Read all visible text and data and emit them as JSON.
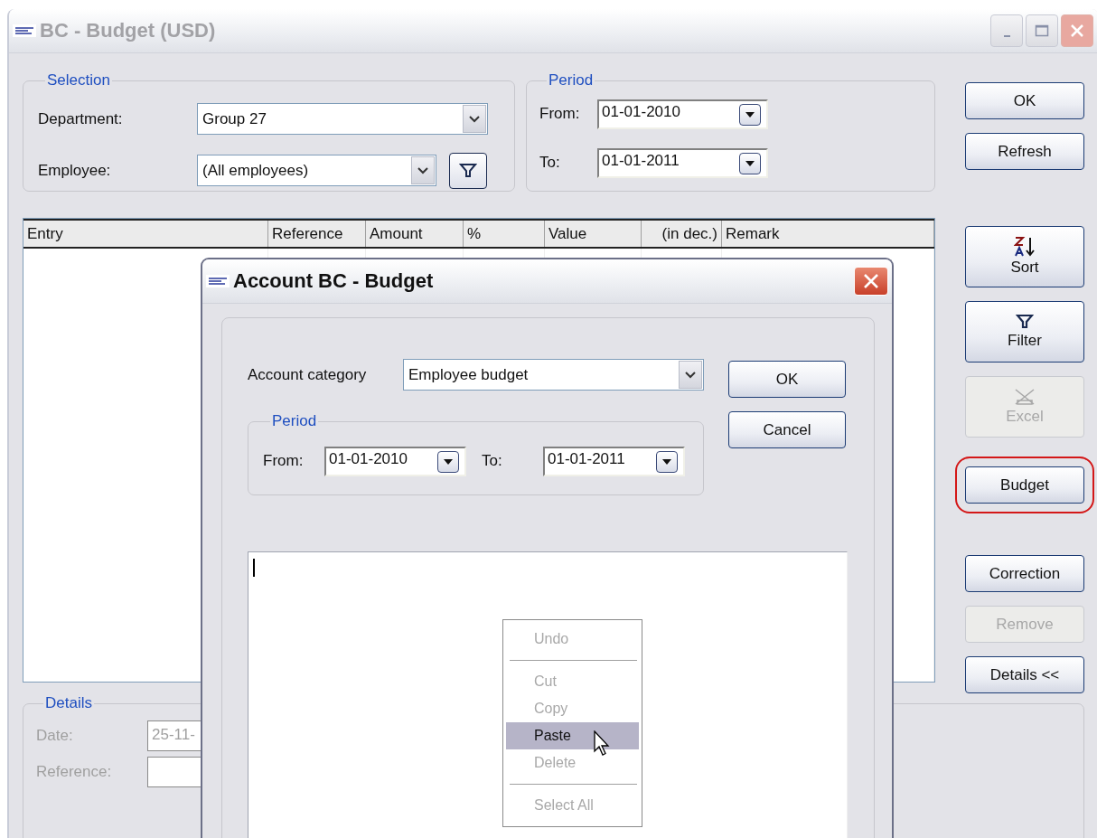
{
  "window": {
    "title": "BC - Budget (USD)",
    "active": false
  },
  "selection": {
    "legend": "Selection",
    "department": {
      "label": "Department:",
      "value": "Group 27"
    },
    "employee": {
      "label": "Employee:",
      "value": "(All employees)"
    }
  },
  "period": {
    "legend": "Period",
    "from": {
      "label": "From:",
      "value": "01-01-2010"
    },
    "to": {
      "label": "To:",
      "value": "01-01-2011"
    }
  },
  "table": {
    "columns": [
      {
        "label": "Entry"
      },
      {
        "label": "Reference"
      },
      {
        "label": "Amount"
      },
      {
        "label": "%"
      },
      {
        "label": "Value"
      },
      {
        "label": "(in dec.)"
      },
      {
        "label": "Remark"
      }
    ]
  },
  "side_buttons": [
    [
      {
        "label": "OK",
        "kind": "text",
        "disabled": false,
        "circled": false
      },
      {
        "label": "Refresh",
        "kind": "text",
        "disabled": false,
        "circled": false
      }
    ],
    [
      {
        "label": "Sort",
        "kind": "sort",
        "disabled": false,
        "circled": false
      },
      {
        "label": "Filter",
        "kind": "filter",
        "disabled": false,
        "circled": false
      },
      {
        "label": "Excel",
        "kind": "excel",
        "disabled": true,
        "circled": false
      }
    ],
    [
      {
        "label": "Budget",
        "kind": "text",
        "disabled": false,
        "circled": true
      }
    ],
    [
      {
        "label": "Correction",
        "kind": "text",
        "disabled": false,
        "circled": false
      },
      {
        "label": "Remove",
        "kind": "text",
        "disabled": true,
        "circled": false
      },
      {
        "label": "Details <<",
        "kind": "text",
        "disabled": false,
        "circled": false
      }
    ]
  ],
  "details": {
    "legend": "Details",
    "fields": [
      {
        "label": "Date:",
        "value": "25-11-",
        "disabled": true
      },
      {
        "label": "Reference:",
        "disabled": true
      }
    ]
  },
  "dialog": {
    "title": "Account BC - Budget",
    "active": true,
    "account_category": {
      "label": "Account category",
      "value": "Employee budget"
    },
    "buttons": [
      "OK",
      "Cancel"
    ],
    "period": {
      "legend": "Period",
      "from": {
        "label": "From:",
        "value": "01-01-2010"
      },
      "to": {
        "label": "To:",
        "value": "01-01-2011"
      }
    },
    "context_menu": [
      {
        "kind": "item",
        "label": "Undo",
        "disabled": true,
        "selected": false
      },
      {
        "kind": "separator"
      },
      {
        "kind": "item",
        "label": "Cut",
        "disabled": true,
        "selected": false
      },
      {
        "kind": "item",
        "label": "Copy",
        "disabled": true,
        "selected": false
      },
      {
        "kind": "item",
        "label": "Paste",
        "disabled": false,
        "selected": true
      },
      {
        "kind": "item",
        "label": "Delete",
        "disabled": true,
        "selected": false
      },
      {
        "kind": "separator"
      },
      {
        "kind": "item",
        "label": "Select All",
        "disabled": true,
        "selected": false
      }
    ]
  }
}
